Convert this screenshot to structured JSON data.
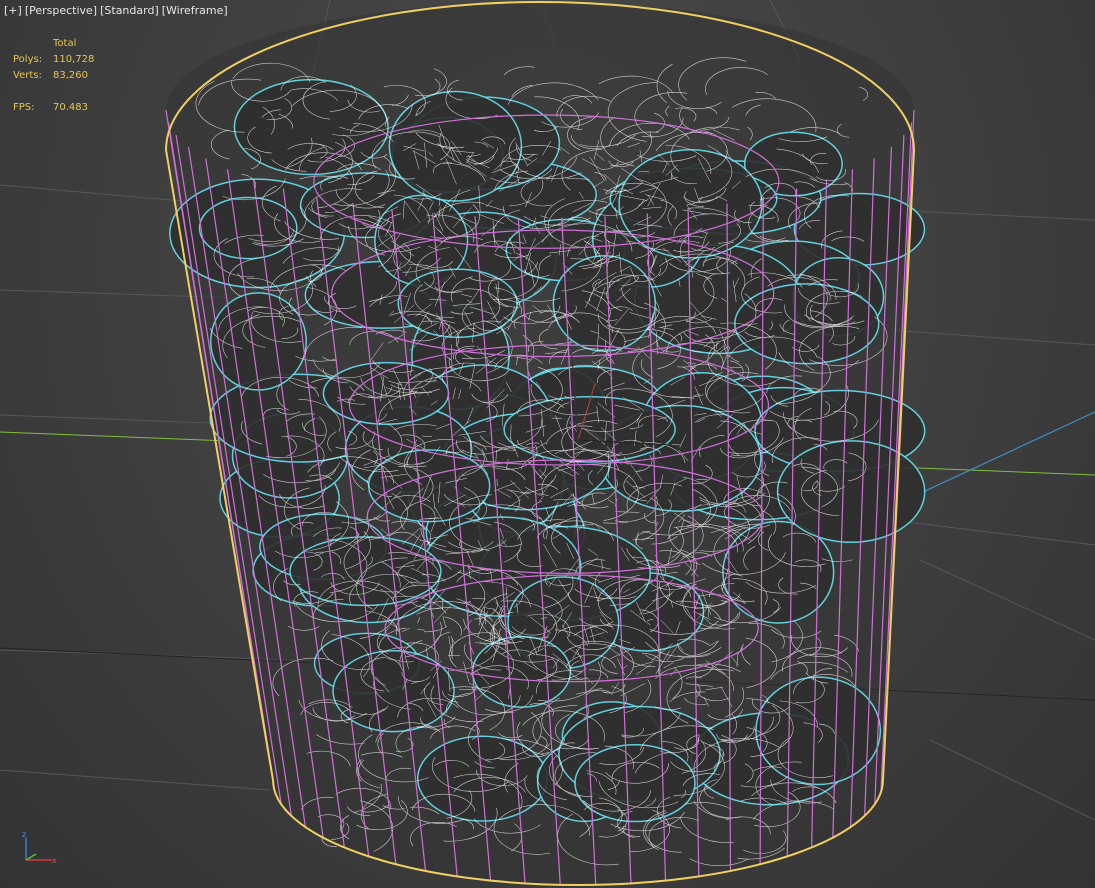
{
  "viewport_menu": {
    "plus": "[+]",
    "view": "[Perspective]",
    "shading_std": "[Standard]",
    "shading_mode": "[Wireframe]"
  },
  "stats": {
    "header": "Total",
    "polys_label": "Polys:",
    "polys_value": "110,728",
    "verts_label": "Verts:",
    "verts_value": "83,260",
    "fps_label": "FPS:",
    "fps_value": "70.483"
  },
  "axis_labels": {
    "z": "z",
    "x": "x"
  },
  "colors": {
    "stats_text": "#e8c54a",
    "container_outline": "#f0d060",
    "container_wire": "#d070d8",
    "object_outline": "#66e0ee",
    "object_wire": "#ffffff",
    "grid": "#5a5a5a",
    "axis_x": "#7fbf3f",
    "axis_y": "#3a9ad9"
  }
}
